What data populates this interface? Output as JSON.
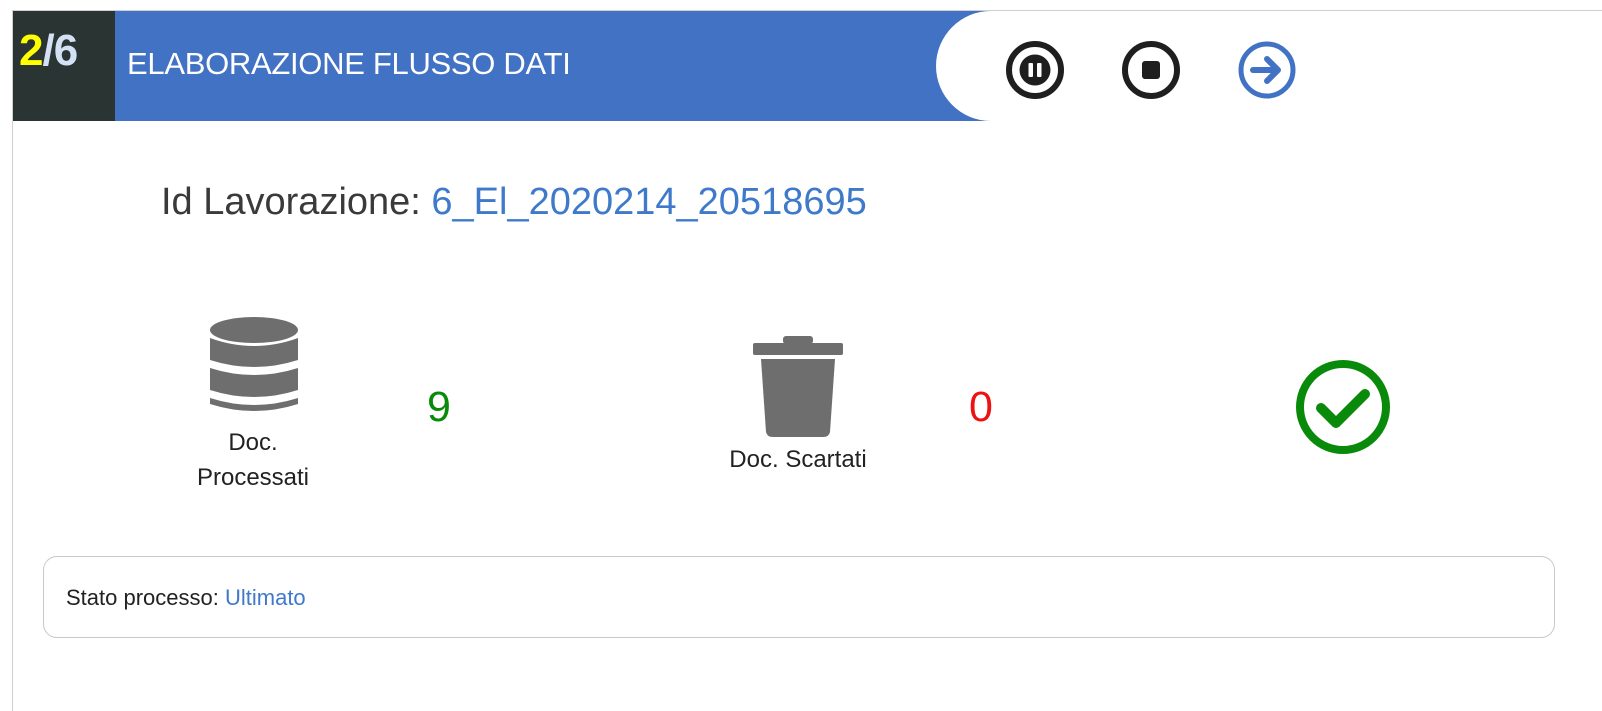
{
  "header": {
    "step_current": "2",
    "step_separator": "/",
    "step_total": "6",
    "title": "ELABORAZIONE FLUSSO DATI",
    "controls": [
      {
        "name": "pause",
        "icon": "pause-circle-icon"
      },
      {
        "name": "stop",
        "icon": "stop-circle-icon"
      },
      {
        "name": "next",
        "icon": "arrow-right-circle-icon"
      }
    ]
  },
  "job": {
    "id_label": "Id Lavorazione: ",
    "id_value": "6_El_2020214_20518695"
  },
  "stats": {
    "processed": {
      "icon": "database-icon",
      "label_line1": "Doc.",
      "label_line2": "Processati",
      "value": "9",
      "value_color": "#0a8a0a"
    },
    "discarded": {
      "icon": "trash-icon",
      "label": "Doc. Scartati",
      "value": "0",
      "value_color": "#ee1111"
    },
    "completion": {
      "icon": "check-circle-icon",
      "color": "#0a8a0a"
    }
  },
  "status": {
    "label": "Stato processo: ",
    "value": "Ultimato"
  },
  "colors": {
    "header_blue": "#4272c4",
    "badge_dark": "#2a3433",
    "step_yellow": "#ffff00",
    "link_blue": "#3e7ac9",
    "icon_gray": "#6e6e6e",
    "success_green": "#0a8a0a",
    "error_red": "#ee1111"
  }
}
